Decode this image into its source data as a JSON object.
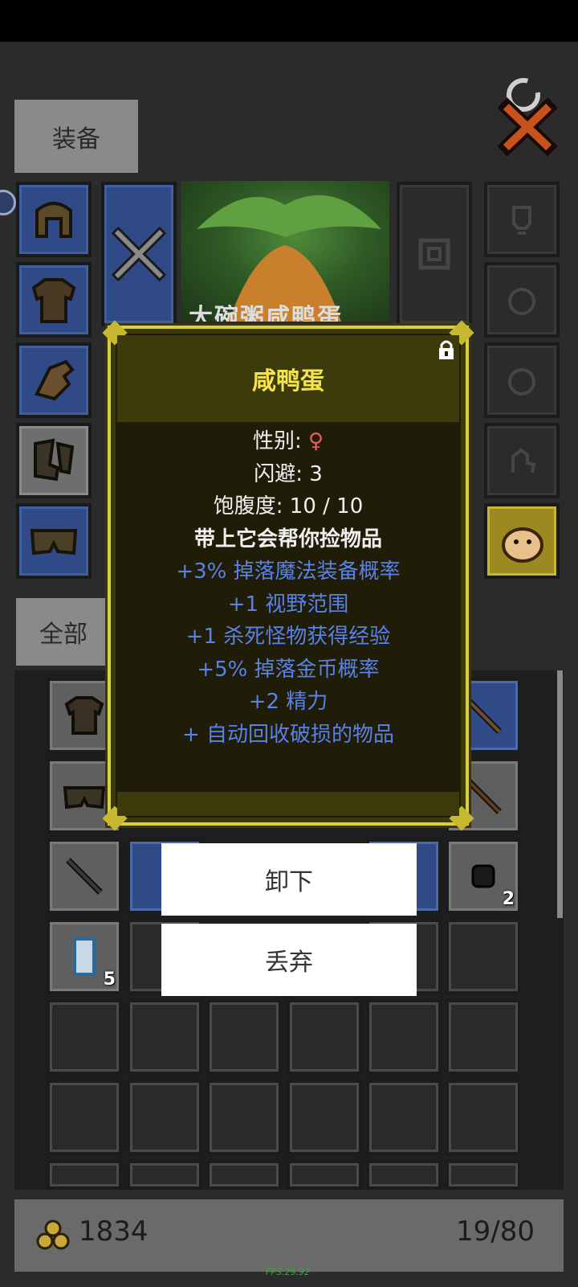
{
  "tabs": {
    "equip": "装备",
    "all": "全部"
  },
  "equipment": {
    "badge_icon": "level-badge-icon",
    "item_art_title": "大碗粥咸鸭蛋"
  },
  "popup": {
    "title": "咸鸭蛋",
    "lock_icon": "lock-icon",
    "gender_label": "性别:",
    "gender_symbol": "♀",
    "dodge": "闪避: 3",
    "satiety": "饱腹度: 10 / 10",
    "desc": "带上它会帮你捡物品",
    "bonuses": [
      "+3% 掉落魔法装备概率",
      "+1 视野范围",
      "+1 杀死怪物获得经验",
      "+5% 掉落金币概率",
      "+2 精力",
      "+ 自动回收破损的物品"
    ]
  },
  "menu": {
    "unequip": "卸下",
    "drop": "丢弃"
  },
  "inventory": {
    "counts": {
      "ore": "2",
      "scroll": "5"
    }
  },
  "footer": {
    "gold": "1834",
    "capacity": "19/80",
    "gold_icon": "gold-coins-icon"
  },
  "fps": "FPS:29.92",
  "colors": {
    "popup_border": "#d8d040",
    "title": "#f4e44a",
    "bonus": "#5a82e6",
    "female": "#e85c5c"
  }
}
